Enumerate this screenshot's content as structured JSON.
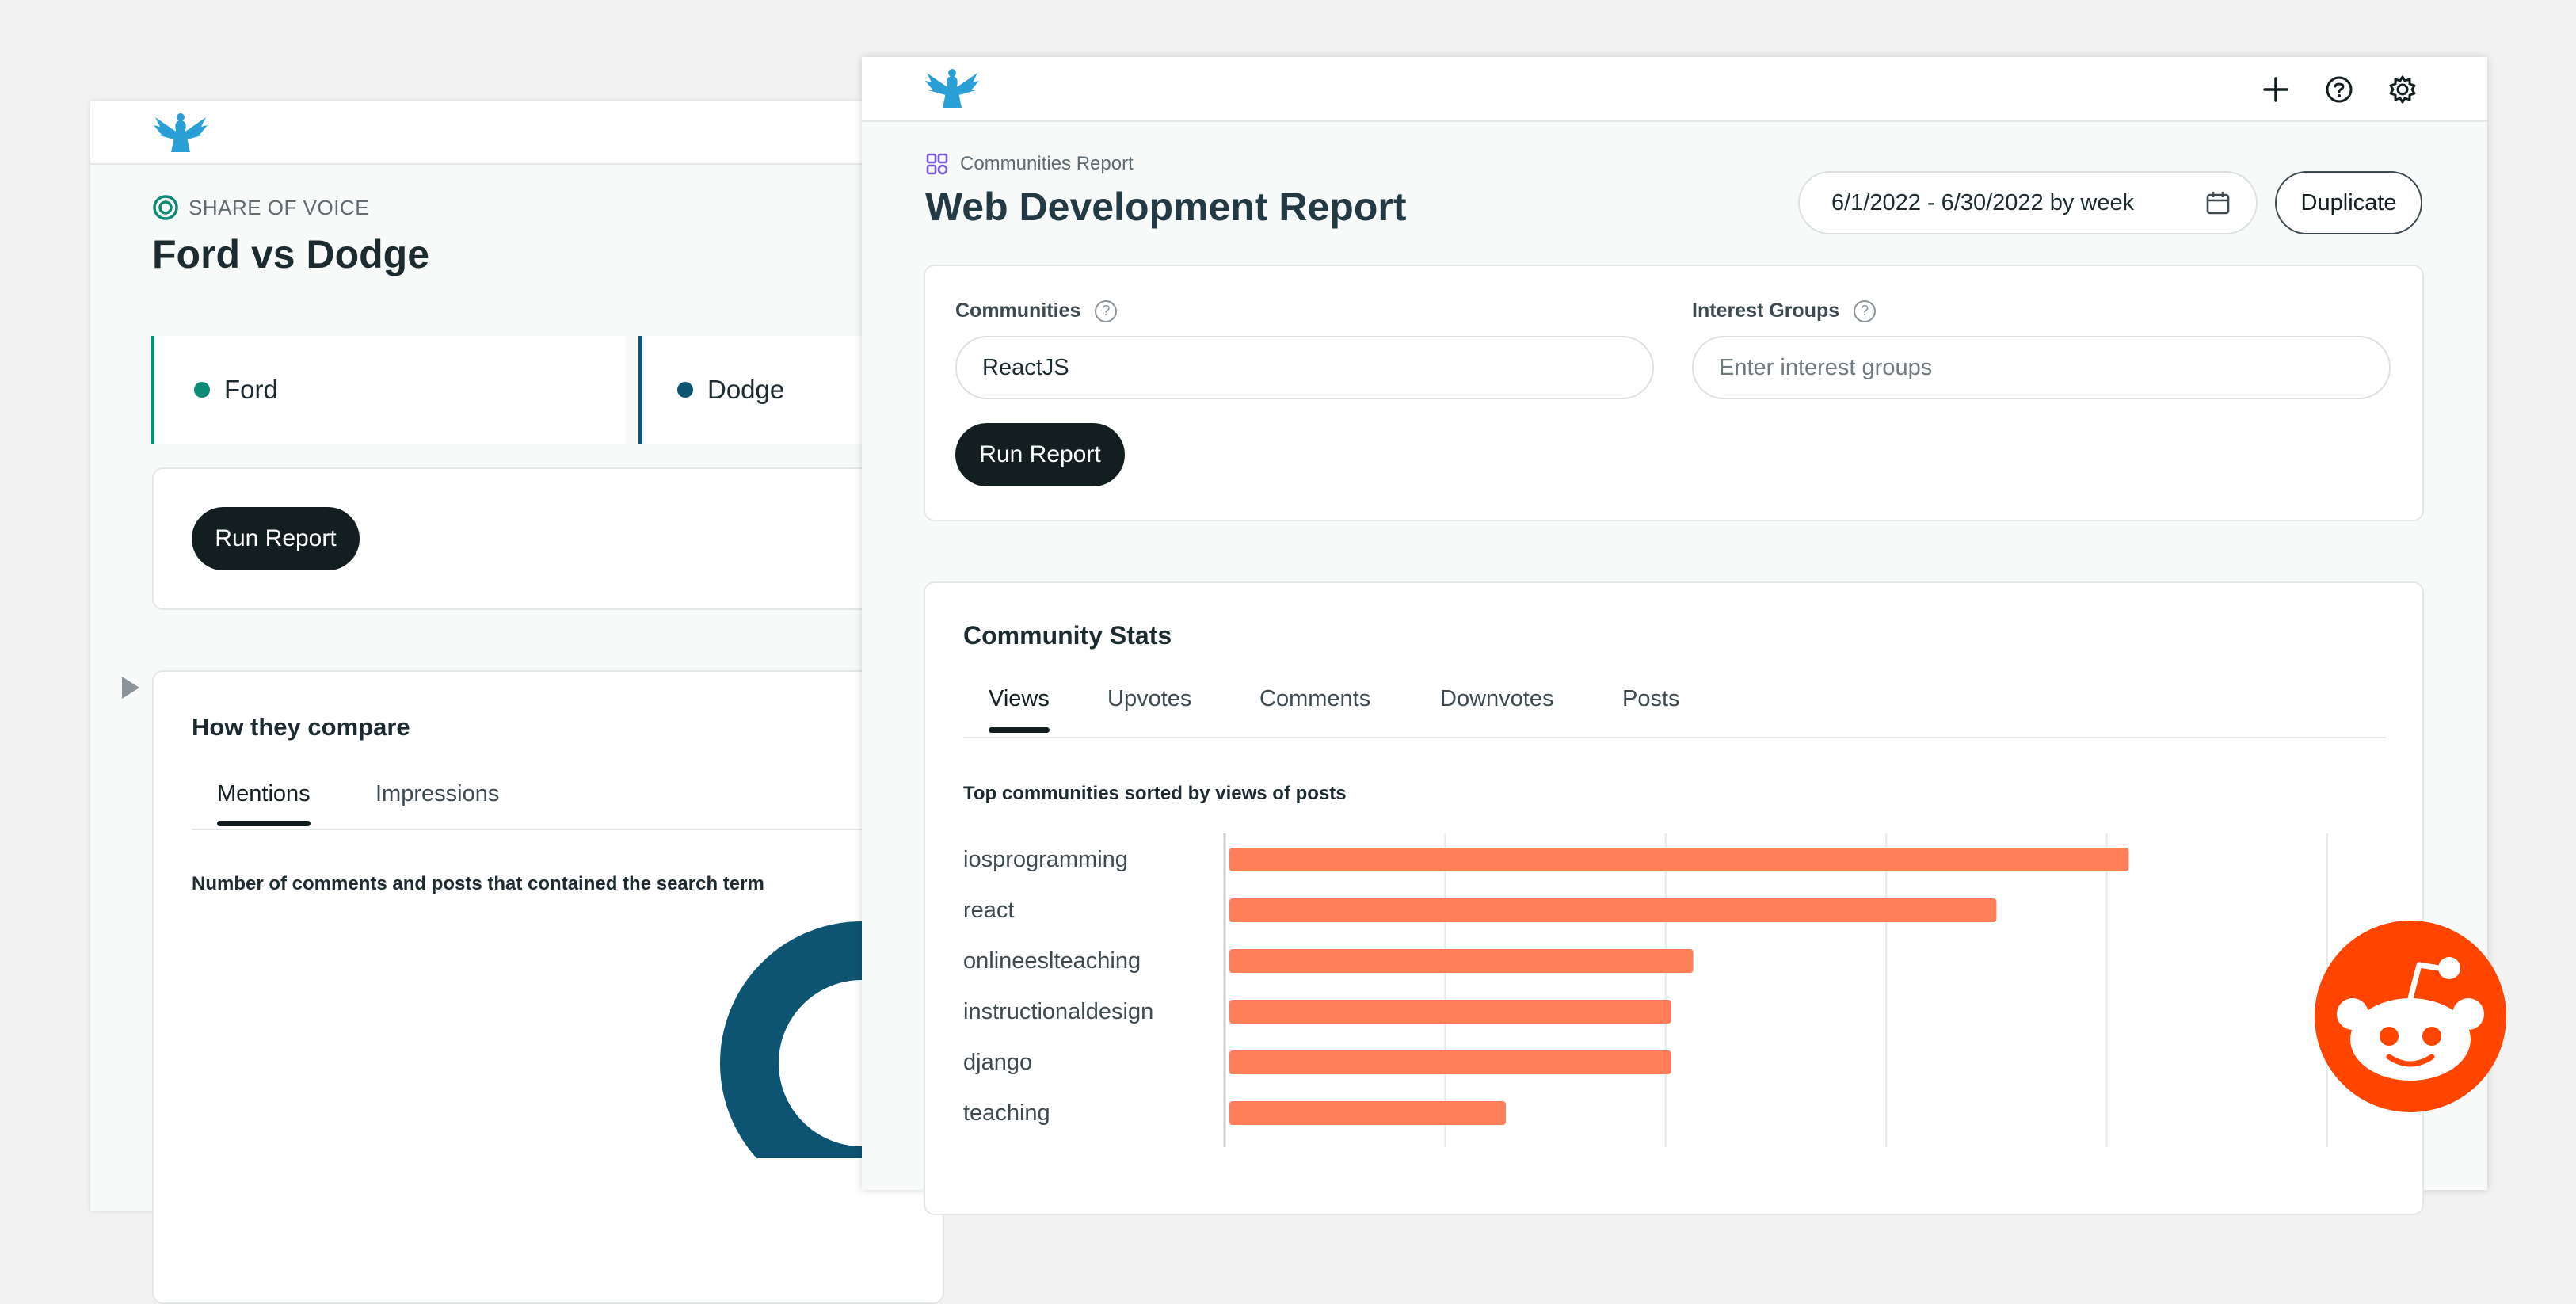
{
  "colors": {
    "ford": "#0b8a76",
    "dodge": "#0d5472",
    "bar": "#ff7d57",
    "reddit": "#ff4500",
    "logo": "#2a9fd6",
    "button": "#121e20"
  },
  "back_window": {
    "logo_icon": "eagle-logo-icon",
    "kicker_icon": "share-of-voice-icon",
    "kicker": "SHARE OF VOICE",
    "title": "Ford vs Dodge",
    "brands": [
      {
        "label": "Ford"
      },
      {
        "label": "Dodge"
      }
    ],
    "run_button": "Run Report",
    "compare": {
      "title": "How they compare",
      "tabs": [
        {
          "label": "Mentions",
          "active": true
        },
        {
          "label": "Impressions",
          "active": false
        }
      ],
      "subtitle": "Number of comments and posts that contained the search term"
    }
  },
  "front_window": {
    "logo_icon": "eagle-logo-icon",
    "top_icons": [
      "plus-icon",
      "help-icon",
      "gear-icon"
    ],
    "breadcrumb_icon": "communities-icon",
    "breadcrumb": "Communities Report",
    "title": "Web Development Report",
    "date_range": "6/1/2022 - 6/30/2022 by week",
    "duplicate_button": "Duplicate",
    "filters": {
      "communities": {
        "label": "Communities",
        "value": "ReactJS"
      },
      "interest_groups": {
        "label": "Interest Groups",
        "placeholder": "Enter interest groups"
      },
      "run_button": "Run Report"
    },
    "stats": {
      "title": "Community Stats",
      "tabs": [
        {
          "label": "Views",
          "active": true
        },
        {
          "label": "Upvotes",
          "active": false
        },
        {
          "label": "Comments",
          "active": false
        },
        {
          "label": "Downvotes",
          "active": false
        },
        {
          "label": "Posts",
          "active": false
        }
      ],
      "chart_subtitle": "Top communities sorted by views of posts"
    }
  },
  "chart_data": {
    "type": "bar",
    "orientation": "horizontal",
    "title": "Top communities sorted by views of posts",
    "categories": [
      "iosprogramming",
      "react",
      "onlineeslteaching",
      "instructionaldesign",
      "django",
      "teaching"
    ],
    "values": [
      82,
      70,
      42.5,
      40.5,
      40.5,
      25.5
    ],
    "xlim": [
      0,
      100
    ],
    "grid": true,
    "xlabel": "",
    "ylabel": ""
  },
  "reddit_badge_icon": "reddit-logo-icon"
}
